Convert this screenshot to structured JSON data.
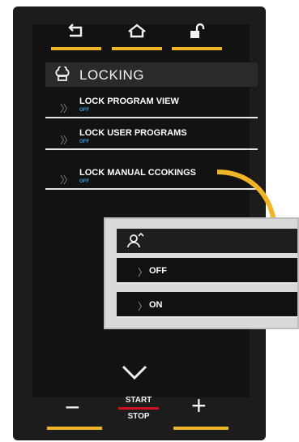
{
  "nav": {
    "back_icon": "back-arrow-icon",
    "home_icon": "home-icon",
    "lock_icon": "unlock-icon"
  },
  "header": {
    "title": "LOCKING",
    "icon": "chef-hat-icon"
  },
  "items": [
    {
      "label": "LOCK PROGRAM VIEW",
      "state": "OFF"
    },
    {
      "label": "LOCK USER PROGRAMS",
      "state": "OFF"
    },
    {
      "label": "LOCK MANUAL CCOKINGS",
      "state": "OFF"
    }
  ],
  "popup": {
    "header_icon": "user-lock-icon",
    "options": [
      {
        "label": "OFF"
      },
      {
        "label": "ON"
      }
    ]
  },
  "controls": {
    "minus": "−",
    "plus": "+",
    "start": "START",
    "stop": "STOP"
  },
  "colors": {
    "accent": "#f0b429",
    "state_blue": "#3aa1e0",
    "stop_red": "#d0141f"
  }
}
